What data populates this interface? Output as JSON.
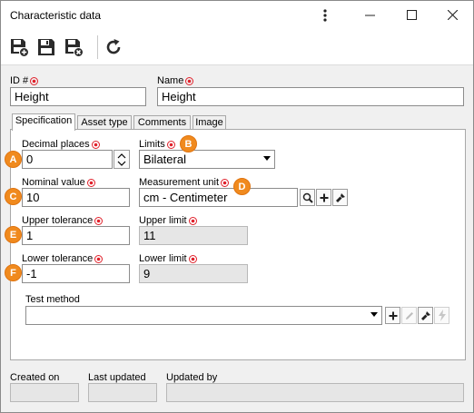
{
  "window": {
    "title": "Characteristic data"
  },
  "header": {
    "id_label": "ID #",
    "id_value": "Height",
    "name_label": "Name",
    "name_value": "Height"
  },
  "tabs": [
    {
      "label": "Specification",
      "active": true
    },
    {
      "label": "Asset type",
      "active": false
    },
    {
      "label": "Comments",
      "active": false
    },
    {
      "label": "Image",
      "active": false
    }
  ],
  "spec": {
    "decimal_places_label": "Decimal places",
    "decimal_places_value": "0",
    "limits_label": "Limits",
    "limits_value": "Bilateral",
    "nominal_value_label": "Nominal value",
    "nominal_value": "10",
    "measurement_unit_label": "Measurement unit",
    "measurement_unit_value": "cm - Centimeter",
    "upper_tolerance_label": "Upper tolerance",
    "upper_tolerance_value": "1",
    "upper_limit_label": "Upper limit",
    "upper_limit_value": "11",
    "lower_tolerance_label": "Lower tolerance",
    "lower_tolerance_value": "-1",
    "lower_limit_label": "Lower limit",
    "lower_limit_value": "9",
    "test_method_label": "Test method",
    "test_method_value": ""
  },
  "badges": {
    "a": "A",
    "b": "B",
    "c": "C",
    "d": "D",
    "e": "E",
    "f": "F"
  },
  "footer": {
    "created_on_label": "Created on",
    "created_on_value": "",
    "last_updated_label": "Last updated",
    "last_updated_value": "",
    "updated_by_label": "Updated by",
    "updated_by_value": ""
  },
  "colors": {
    "required": "#e0212b",
    "badge": "#f08a1e",
    "tab_active": "#ffffff"
  },
  "icons": [
    "kebab-menu-icon",
    "minimize-icon",
    "maximize-icon",
    "close-icon",
    "save-new-icon",
    "save-icon",
    "save-close-icon",
    "refresh-icon",
    "spin-up-icon",
    "spin-down-icon",
    "search-icon",
    "plus-icon",
    "brush-icon",
    "pencil-icon",
    "lightning-icon"
  ]
}
